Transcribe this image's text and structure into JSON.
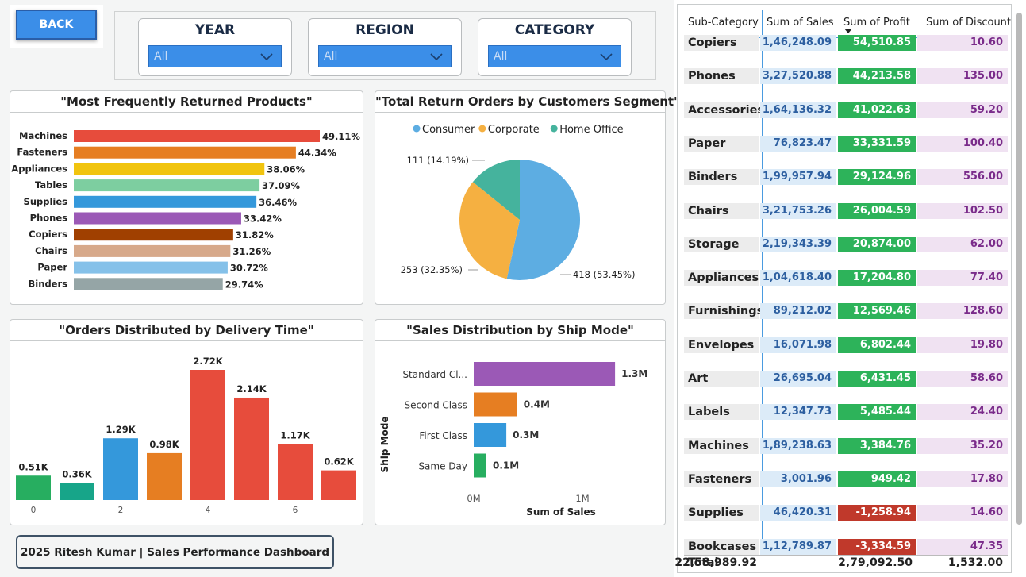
{
  "back_button": "BACK",
  "slicers": [
    {
      "title": "YEAR",
      "value": "All"
    },
    {
      "title": "REGION",
      "value": "All"
    },
    {
      "title": "CATEGORY",
      "value": "All"
    }
  ],
  "footer": "2025 Ritesh Kumar | Sales Performance Dashboard",
  "colors": {
    "accent_blue": "#3b8ee8",
    "profit_positive": "#2db35a",
    "profit_negative": "#c0392b"
  },
  "chart_data": [
    {
      "type": "bar",
      "orientation": "horizontal",
      "title": "\"Most Frequently Returned Products\"",
      "categories": [
        "Machines",
        "Fasteners",
        "Appliances",
        "Tables",
        "Supplies",
        "Phones",
        "Copiers",
        "Chairs",
        "Paper",
        "Binders"
      ],
      "values": [
        49.11,
        44.34,
        38.06,
        37.09,
        36.46,
        33.42,
        31.82,
        31.26,
        30.72,
        29.74
      ],
      "labels": [
        "49.11%",
        "44.34%",
        "38.06%",
        "37.09%",
        "36.46%",
        "33.42%",
        "31.82%",
        "31.26%",
        "30.72%",
        "29.74%"
      ],
      "colors": [
        "#e74c3c",
        "#e67e22",
        "#f1c40f",
        "#7dcea0",
        "#3498db",
        "#9b59b6",
        "#a04000",
        "#d7a98a",
        "#85c1e9",
        "#95a5a6"
      ]
    },
    {
      "type": "pie",
      "title": "\"Total Return Orders by Customers Segment\"",
      "legend": "top",
      "slices": [
        {
          "name": "Consumer",
          "value": 418,
          "label": "418 (53.45%)",
          "color": "#5dade2"
        },
        {
          "name": "Corporate",
          "value": 253,
          "label": "253 (32.35%)",
          "color": "#f5b041"
        },
        {
          "name": "Home Office",
          "value": 111,
          "label": "111 (14.19%)",
          "color": "#45b39d"
        }
      ]
    },
    {
      "type": "bar",
      "title": "\"Orders Distributed by Delivery Time\"",
      "x": [
        0,
        1,
        2,
        3,
        4,
        5,
        6,
        7
      ],
      "x_tick_labels": [
        "0",
        "",
        "2",
        "",
        "4",
        "",
        "6",
        ""
      ],
      "values": [
        0.51,
        0.36,
        1.29,
        0.98,
        2.72,
        2.14,
        1.17,
        0.62
      ],
      "labels": [
        "0.51K",
        "0.36K",
        "1.29K",
        "0.98K",
        "2.72K",
        "2.14K",
        "1.17K",
        "0.62K"
      ],
      "colors": [
        "#27ae60",
        "#17a589",
        "#3498db",
        "#e67e22",
        "#e74c3c",
        "#e74c3c",
        "#e74c3c",
        "#e74c3c"
      ],
      "ylim": [
        0,
        2.72
      ]
    },
    {
      "type": "bar",
      "orientation": "horizontal",
      "title": "\"Sales Distribution by Ship Mode\"",
      "categories": [
        "Standard Cl...",
        "Second Class",
        "First Class",
        "Same Day"
      ],
      "values": [
        1.3,
        0.4,
        0.3,
        0.1
      ],
      "labels": [
        "1.3M",
        "0.4M",
        "0.3M",
        "0.1M"
      ],
      "colors": [
        "#9b59b6",
        "#e67e22",
        "#3498db",
        "#27ae60"
      ],
      "xlabel": "Sum of Sales",
      "ylabel": "Ship Mode",
      "x_tick_labels": [
        "0M",
        "1M"
      ],
      "xlim": [
        0,
        1.6
      ]
    },
    {
      "type": "table",
      "headers": [
        "Sub-Category",
        "Sum of Sales",
        "Sum of Profit",
        "Sum of Discount"
      ],
      "sorted_by": "Sum of Profit",
      "rows": [
        [
          "Copiers",
          "1,46,248.09",
          "54,510.85",
          "10.60"
        ],
        [
          "Phones",
          "3,27,520.88",
          "44,213.58",
          "135.00"
        ],
        [
          "Accessories",
          "1,64,136.32",
          "41,022.63",
          "59.20"
        ],
        [
          "Paper",
          "76,823.47",
          "33,331.59",
          "100.40"
        ],
        [
          "Binders",
          "1,99,957.94",
          "29,124.96",
          "556.00"
        ],
        [
          "Chairs",
          "3,21,753.26",
          "26,004.59",
          "102.50"
        ],
        [
          "Storage",
          "2,19,343.39",
          "20,874.00",
          "62.00"
        ],
        [
          "Appliances",
          "1,04,618.40",
          "17,204.80",
          "77.40"
        ],
        [
          "Furnishings",
          "89,212.02",
          "12,569.46",
          "128.60"
        ],
        [
          "Envelopes",
          "16,071.98",
          "6,802.44",
          "19.80"
        ],
        [
          "Art",
          "26,695.04",
          "6,431.45",
          "58.60"
        ],
        [
          "Labels",
          "12,347.73",
          "5,485.44",
          "24.40"
        ],
        [
          "Machines",
          "1,89,238.63",
          "3,384.76",
          "35.20"
        ],
        [
          "Fasteners",
          "3,001.96",
          "949.42",
          "17.80"
        ],
        [
          "Supplies",
          "46,420.31",
          "-1,258.94",
          "14.60"
        ],
        [
          "Bookcases",
          "1,12,789.87",
          "-3,334.59",
          "47.35"
        ]
      ],
      "total": [
        "Total",
        "22,58,989.92",
        "2,79,092.50",
        "1,532.00"
      ]
    }
  ]
}
